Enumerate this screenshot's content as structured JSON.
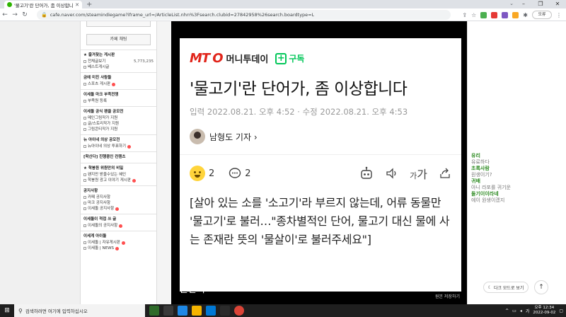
{
  "browser": {
    "tab_title": "'물고기'란 단어가, 좀 이상합니다",
    "new_tab": "+",
    "url": "cafe.naver.com/steamindiegame?iframe_url=/ArticleList.nhn%3Fsearch.clubid=27842958%26search.boardtype=L",
    "window_controls": [
      "–",
      "❐",
      "✕"
    ],
    "profile_label": "오류"
  },
  "sidebar": {
    "chat_button": "카페 채팅",
    "sections": [
      {
        "header": "★ 즐겨찾는 게시판",
        "items": [
          {
            "label": "전체글보기",
            "count": "5,773,235"
          },
          {
            "label": "베스트게시글"
          }
        ]
      },
      {
        "header": "금예 미친 사람들",
        "items": [
          {
            "label": "스포츠 게시판",
            "badge": true
          }
        ]
      },
      {
        "header": "이세돌 마크 부족전쟁",
        "items": [
          {
            "label": "부족원 등록"
          }
        ]
      },
      {
        "header": "이세돌 공식 팬클 공모전",
        "items": [
          {
            "label": "메인그림작가 지원"
          },
          {
            "label": "글/스토리작가 지원"
          },
          {
            "label": "그림콘티작가 지원"
          }
        ]
      },
      {
        "header": "뉴 아이네 의상 공모전",
        "items": [
          {
            "label": "뉴아이네 의상 투표하기",
            "badge": true
          }
        ]
      },
      {
        "header": "[학산다] 진행중인 컨텐츠",
        "items": []
      },
      {
        "header": "★ 학붕원 위원만의 비밀",
        "items": [
          {
            "label": "왠지만 받을수있는 혜인"
          },
          {
            "label": "학붕원 광고 이야기 게시판",
            "badge": true
          }
        ]
      },
      {
        "header": "공지사항",
        "items": [
          {
            "label": "카페 공지사항"
          },
          {
            "label": "마크 공지사항"
          },
          {
            "label": "이세돌 공지사항",
            "badge": true
          }
        ]
      },
      {
        "header": "이세돌이 적접 쓰 글",
        "items": [
          {
            "label": "이세돌의 공지사항",
            "badge": true
          }
        ]
      },
      {
        "header": "이세계 아이돌",
        "items": [
          {
            "label": "이세돌 | 자유게시판",
            "badge": true
          },
          {
            "label": "이세돌 | NEWS",
            "badge": true
          }
        ]
      }
    ]
  },
  "video": {
    "logo_mt": "MT",
    "logo_o": "O",
    "logo_name": "머니투데이",
    "subscribe_plus": "+",
    "subscribe_label": "구독",
    "headline": "'물고기'란 단어가, 좀 이상합니다",
    "dates": "입력 2022.08.21. 오후 4:52 · 수정 2022.08.21. 오후 4:53",
    "author": "남형도 기자 ›",
    "reaction_count": "2",
    "comment_count": "2",
    "text_size_small": "가",
    "text_size_big": "가",
    "quote": "[살아 있는 소를 '소고기'라 부르지 않는데, 어류 동물만 '물고기'로 불러…\"종차별적인 단어, 물고기 대신 물에 사는 존재란 뜻의 '물살이'로 불러주세요\"]",
    "subtitle": "물살이 ㅋㅋㅋㅋㅋㅋ",
    "credit": "원본 저장하기"
  },
  "chat": {
    "messages": [
      {
        "name": "유리",
        "msg": "유료하다"
      },
      {
        "name": "초록사람",
        "msg": "원생이기?"
      },
      {
        "name": "귀배",
        "msg": "아니 라포를 귀기운"
      },
      {
        "name": "둘기이이라네",
        "msg": "에이 원생이겠지"
      }
    ],
    "dark_mode_label": "다크 모드로 보기",
    "dark_mode_icon": "☾",
    "scroll_top": "↑"
  },
  "taskbar": {
    "search_placeholder": "검색하려면 여기에 입력하십시오",
    "tray_lang": "가",
    "time": "오후 12:34",
    "date": "2022-09-02"
  },
  "colors": {
    "mt_red": "#e1251b",
    "naver_green": "#03c75a",
    "chat_name_green": "#2e8b22"
  }
}
